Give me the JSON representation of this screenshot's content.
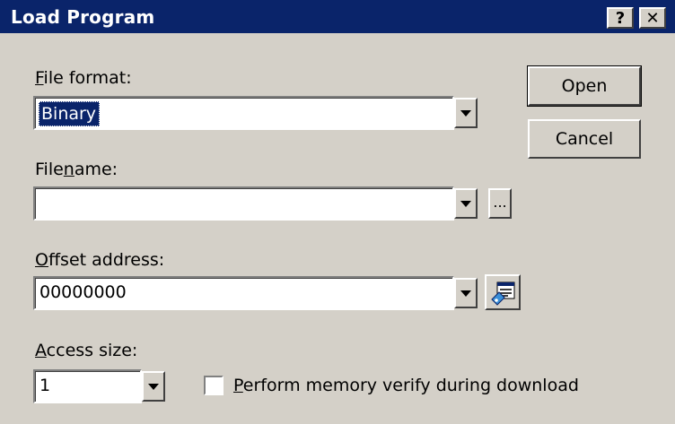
{
  "window": {
    "title": "Load Program",
    "help_label": "?",
    "close_label": "✕"
  },
  "file_format": {
    "label_prefix": "",
    "label_mnemonic": "F",
    "label_rest": "ile format:",
    "value": "Binary"
  },
  "filename": {
    "label_prefix": "File",
    "label_mnemonic": "n",
    "label_rest": "ame:",
    "value": "",
    "browse_label": "..."
  },
  "offset_address": {
    "label_prefix": "",
    "label_mnemonic": "O",
    "label_rest": "ffset address:",
    "value": "00000000"
  },
  "access_size": {
    "label_prefix": "",
    "label_mnemonic": "A",
    "label_rest": "ccess size:",
    "value": "1"
  },
  "verify": {
    "label_prefix": "",
    "label_mnemonic": "P",
    "label_rest": "erform memory verify during download",
    "checked": false
  },
  "buttons": {
    "open_label": "Open",
    "cancel_label": "Cancel"
  }
}
